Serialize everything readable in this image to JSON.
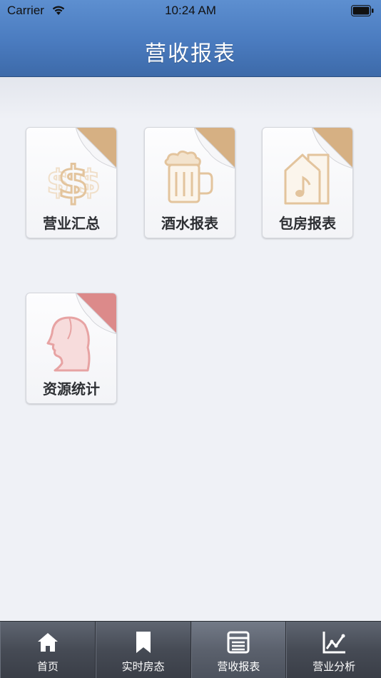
{
  "status_bar": {
    "carrier": "Carrier",
    "time": "10:24 AM"
  },
  "nav": {
    "title": "营收报表"
  },
  "tiles": [
    {
      "label": "营业汇总",
      "icon": "dollar-icon",
      "corner_color": "#d6b083"
    },
    {
      "label": "酒水报表",
      "icon": "beer-mug-icon",
      "corner_color": "#d6b083"
    },
    {
      "label": "包房报表",
      "icon": "music-room-icon",
      "corner_color": "#d6b083"
    },
    {
      "label": "资源统计",
      "icon": "woman-profile-icon",
      "corner_color": "#dc8a8a"
    }
  ],
  "tabbar": {
    "tabs": [
      {
        "label": "首页",
        "icon": "home-icon",
        "active": false
      },
      {
        "label": "实时房态",
        "icon": "bookmark-icon",
        "active": false
      },
      {
        "label": "营收报表",
        "icon": "list-icon",
        "active": true
      },
      {
        "label": "营业分析",
        "icon": "line-chart-icon",
        "active": false
      }
    ]
  },
  "colors": {
    "header": "#4a7bbf",
    "tile_icon_tan": "#e6c9a4",
    "tile_icon_pink": "#e7a3a3"
  }
}
